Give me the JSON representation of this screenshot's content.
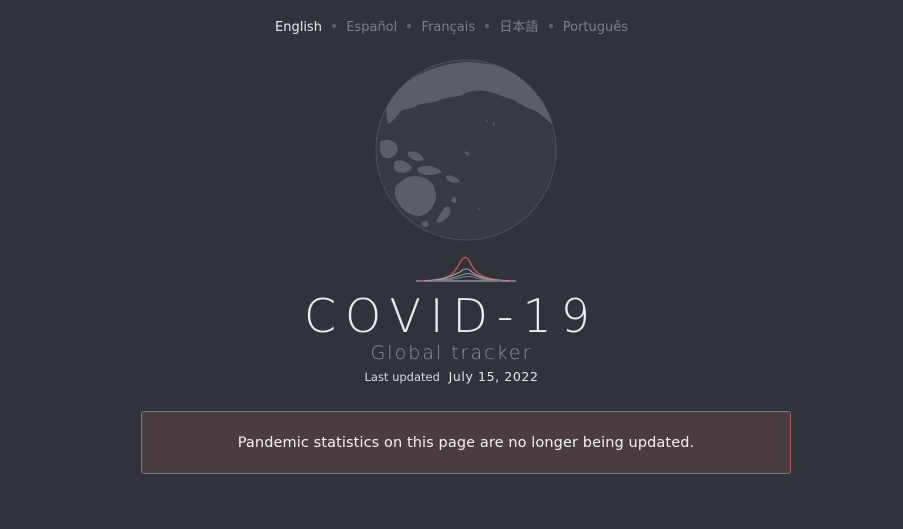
{
  "languages": [
    {
      "label": "English",
      "active": true
    },
    {
      "label": "Español",
      "active": false
    },
    {
      "label": "Français",
      "active": false
    },
    {
      "label": "日本語",
      "active": false
    },
    {
      "label": "Português",
      "active": false
    }
  ],
  "hero": {
    "title": "COVID-19",
    "subtitle": "Global tracker",
    "updated_label": "Last updated",
    "updated_date": "July 15, 2022"
  },
  "notice": {
    "message": "Pandemic statistics on this page are no longer being updated."
  },
  "colors": {
    "background": "#30333b",
    "notice_bg": "#4a3c43",
    "notice_border": "#b4605f",
    "curve_red": "#c0504f"
  },
  "icons": {
    "globe": "globe-icon",
    "curve": "epidemic-curve-icon"
  }
}
